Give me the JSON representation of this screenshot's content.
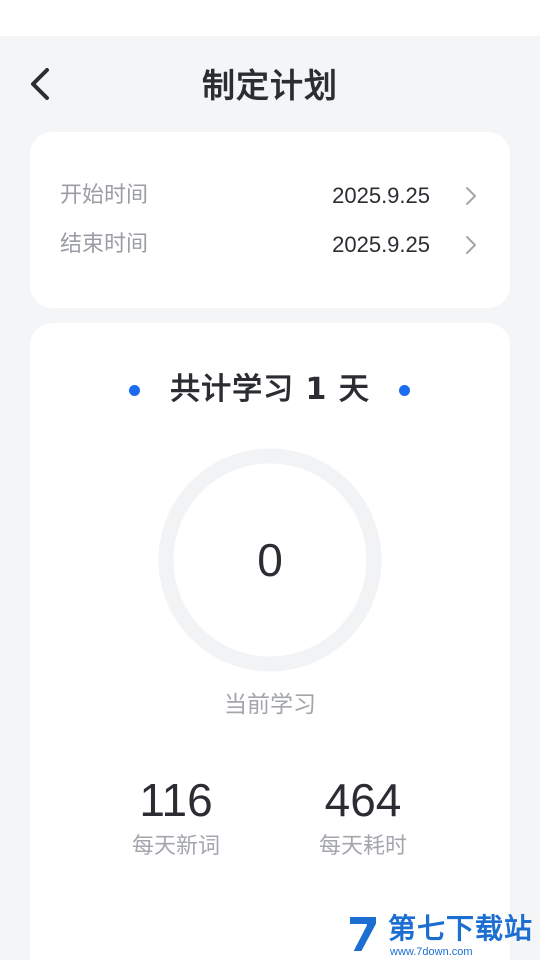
{
  "header": {
    "title": "制定计划",
    "back_icon": "chevron-left-icon"
  },
  "dates": {
    "start_label": "开始时间",
    "start_value": "2025.9.25",
    "end_label": "结束时间",
    "end_value": "2025.9.25",
    "row_icon": "chevron-right-icon"
  },
  "summary": {
    "total_text": "共计学习 1 天",
    "current_value": "0",
    "current_label": "当前学习",
    "daily_words_value": "116",
    "daily_words_label": "每天新词",
    "daily_time_value": "464",
    "daily_time_label": "每天耗时"
  },
  "watermark": {
    "text": "第七下载站",
    "url": "www.7down.com"
  },
  "colors": {
    "accent": "#1b6cf2",
    "background": "#f4f5f7",
    "card": "#ffffff",
    "text_primary": "#2b2d33",
    "text_secondary": "#9a9da4",
    "ring": "#f2f3f5"
  }
}
